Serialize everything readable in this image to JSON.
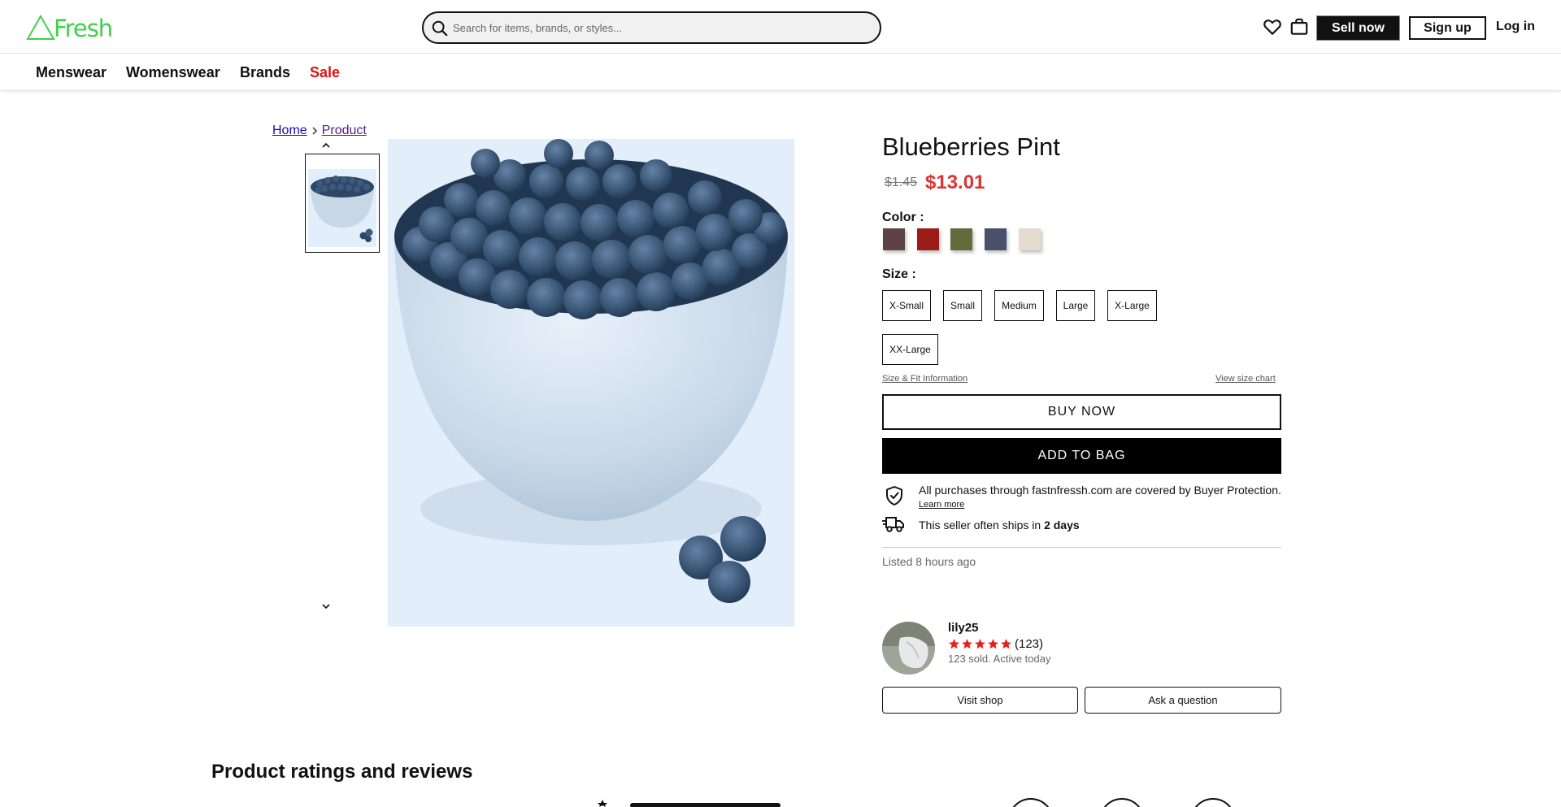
{
  "header": {
    "logo_text": "Fresh",
    "logo_color": "#3fd14a",
    "search_placeholder": "Search for items, brands, or styles...",
    "sell_label": "Sell now",
    "signup_label": "Sign up",
    "login_label": "Log in",
    "icons": [
      "search-icon",
      "heart-icon",
      "shopping-bag-icon"
    ]
  },
  "nav": {
    "items": [
      {
        "label": "Menswear"
      },
      {
        "label": "Womenswear"
      },
      {
        "label": "Brands"
      },
      {
        "label": "Sale",
        "color": "#dd1111"
      }
    ]
  },
  "breadcrumb": {
    "home": "Home",
    "product": "Product"
  },
  "product": {
    "title": "Blueberries Pint",
    "price_old": "$1.45",
    "price_new": "$13.01",
    "color_label": "Color :",
    "colors": [
      "#5e4346",
      "#9a1d18",
      "#636b3b",
      "#4a4f6b",
      "#e4ddcf"
    ],
    "size_label": "Size :",
    "sizes": [
      "X-Small",
      "Small",
      "Medium",
      "Large",
      "X-Large",
      "XX-Large"
    ],
    "size_fit_link": "Size & Fit Information",
    "size_chart_link": "View size chart",
    "buy_now": "BUY NOW",
    "add_to_bag": "ADD TO BAG",
    "protection_text": "All purchases through fastnfressh.com are covered by Buyer Protection.",
    "learn_more": "Learn more",
    "ships_prefix": "This seller often ships in ",
    "ships_days": "2 days",
    "listed": "Listed 8 hours ago"
  },
  "seller": {
    "name": "lily25",
    "rating_stars": 5,
    "review_count": "(123)",
    "meta": "123 sold. Active today",
    "visit_shop": "Visit shop",
    "ask_question": "Ask a question"
  },
  "reviews": {
    "title": "Product ratings and reviews"
  }
}
